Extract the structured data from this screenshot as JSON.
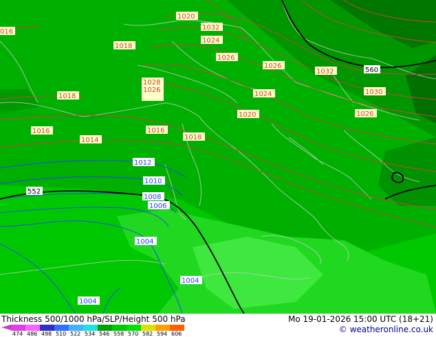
{
  "footer": {
    "title": "Thickness 500/1000 hPa/SLP/Height 500 hPa",
    "datetime": "Mo 19-01-2026 15:00 UTC (18+21)",
    "credit": "© weatheronline.co.uk"
  },
  "legend": {
    "ticks": [
      "474",
      "486",
      "498",
      "510",
      "522",
      "534",
      "546",
      "558",
      "570",
      "582",
      "594",
      "606"
    ],
    "colors": [
      "#e040e0",
      "#ff60ff",
      "#3030c0",
      "#3070ff",
      "#40b0ff",
      "#20e0e0",
      "#00a000",
      "#00c800",
      "#00e000",
      "#e0e000",
      "#ffa000",
      "#ff6000"
    ]
  },
  "map": {
    "colors": {
      "slp_red": "#d04040",
      "slp_blue": "#2040ff",
      "height_black": "#000000",
      "land_border": "#c8c8c8"
    },
    "slp_red_labels": [
      "1020",
      "1032",
      "1024",
      "1018",
      "1026",
      "1026",
      "1032",
      "1028",
      "1026",
      "1018",
      "1024",
      "1030",
      "1020",
      "1026",
      "1016",
      "1016",
      "1014",
      "1018",
      "016"
    ],
    "slp_blue_labels": [
      "1012",
      "1010",
      "1008",
      "1006",
      "1004",
      "1004",
      "1004"
    ],
    "height_labels": [
      "560",
      "552"
    ]
  }
}
